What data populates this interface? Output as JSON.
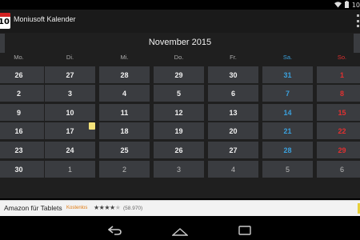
{
  "status_bar": {
    "clock": "10"
  },
  "app": {
    "icon_number": "10",
    "title": "Moniusoft Kalender"
  },
  "calendar": {
    "month_title": "November 2015",
    "weekdays": [
      "Mo.",
      "Di.",
      "Mi.",
      "Do.",
      "Fr.",
      "Sa.",
      "So."
    ],
    "weeks": [
      [
        {
          "d": "26",
          "dim": false
        },
        {
          "d": "27",
          "dim": false
        },
        {
          "d": "28",
          "dim": false
        },
        {
          "d": "29",
          "dim": false
        },
        {
          "d": "30",
          "dim": false
        },
        {
          "d": "31",
          "dim": false
        },
        {
          "d": "1",
          "dim": false
        }
      ],
      [
        {
          "d": "2"
        },
        {
          "d": "3"
        },
        {
          "d": "4"
        },
        {
          "d": "5"
        },
        {
          "d": "6"
        },
        {
          "d": "7"
        },
        {
          "d": "8"
        }
      ],
      [
        {
          "d": "9"
        },
        {
          "d": "10"
        },
        {
          "d": "11"
        },
        {
          "d": "12"
        },
        {
          "d": "13"
        },
        {
          "d": "14"
        },
        {
          "d": "15"
        }
      ],
      [
        {
          "d": "16"
        },
        {
          "d": "17"
        },
        {
          "d": "18"
        },
        {
          "d": "19"
        },
        {
          "d": "20"
        },
        {
          "d": "21"
        },
        {
          "d": "22"
        }
      ],
      [
        {
          "d": "23"
        },
        {
          "d": "24"
        },
        {
          "d": "25"
        },
        {
          "d": "26"
        },
        {
          "d": "27"
        },
        {
          "d": "28"
        },
        {
          "d": "29"
        }
      ],
      [
        {
          "d": "30"
        },
        {
          "d": "1",
          "dim": true
        },
        {
          "d": "2",
          "dim": true
        },
        {
          "d": "3",
          "dim": true
        },
        {
          "d": "4",
          "dim": true
        },
        {
          "d": "5",
          "dim": true
        },
        {
          "d": "6",
          "dim": true
        }
      ]
    ],
    "note_on_day": "17",
    "colors": {
      "saturday": "#3aa0dc",
      "sunday": "#e03030",
      "cell_bg": "#3a3c40"
    }
  },
  "ad": {
    "title": "Amazon für Tablets",
    "badge": "Kostenlos",
    "stars": "★★★★★",
    "rating_count": "(58.970)"
  },
  "nav_icons": [
    "back-icon",
    "home-icon",
    "recents-icon"
  ]
}
